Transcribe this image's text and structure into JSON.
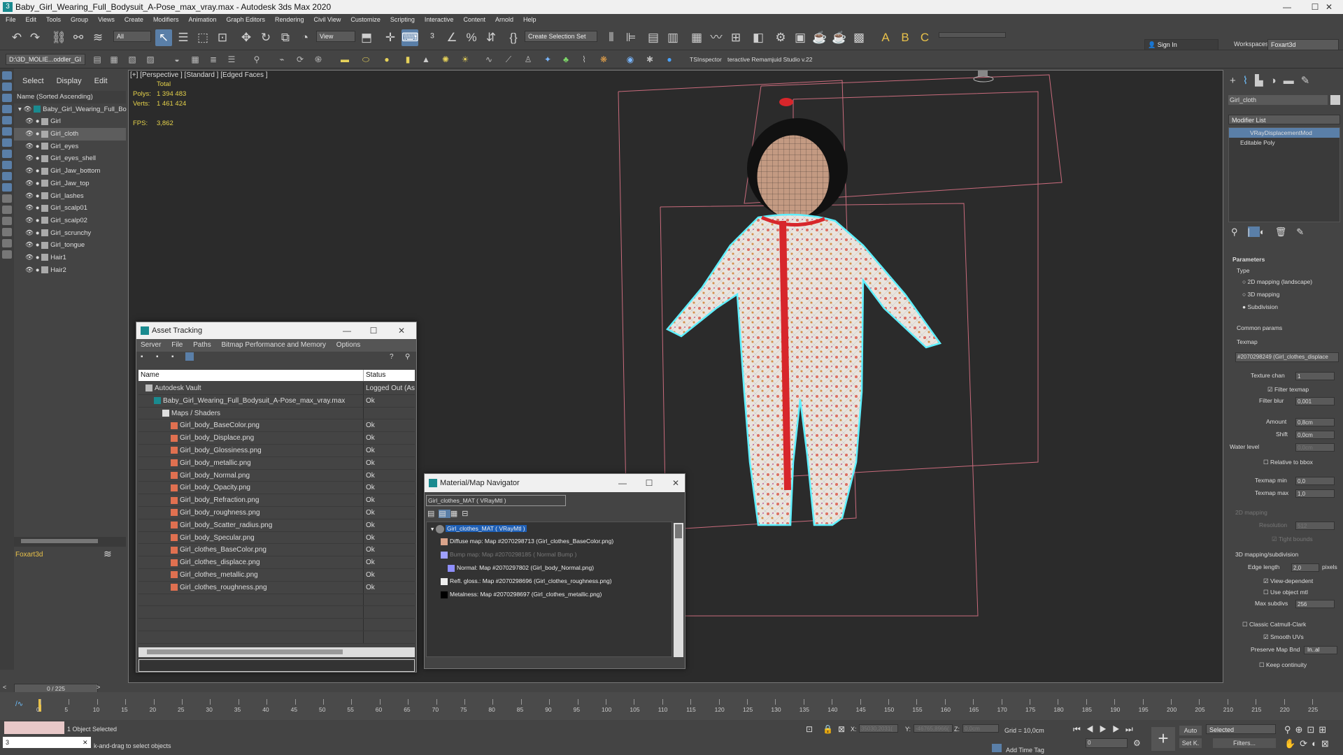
{
  "titlebar": {
    "title": "Baby_Girl_Wearing_Full_Bodysuit_A-Pose_max_vray.max - Autodesk 3ds Max 2020",
    "min": "—",
    "max": "☐",
    "close": "✕"
  },
  "menu": [
    "File",
    "Edit",
    "Tools",
    "Group",
    "Views",
    "Create",
    "Modifiers",
    "Animation",
    "Graph Editors",
    "Rendering",
    "Civil View",
    "Customize",
    "Scripting",
    "Interactive",
    "Content",
    "Arnold",
    "Help"
  ],
  "toolbar": {
    "filter": "All",
    "view": "View",
    "selection_set": "Create Selection Set",
    "sign_in": "Sign In",
    "workspaces_label": "Workspaces:",
    "workspace": "Foxart3d"
  },
  "toolbar2": {
    "path": "D:\\3D_MOLIE...oddler_GI",
    "ts": "TSInspector",
    "interactive": "teractive Remam",
    "studio": "juid Studio v.22"
  },
  "scene": {
    "tabs": [
      "Select",
      "Display",
      "Edit"
    ],
    "header": "Name (Sorted Ascending)",
    "root": "Baby_Girl_Wearing_Full_Bo",
    "items": [
      "Girl",
      "Girl_cloth",
      "Girl_eyes",
      "Girl_eyes_shell",
      "Girl_Jaw_bottom",
      "Girl_Jaw_top",
      "Girl_lashes",
      "Girl_scalp01",
      "Girl_scalp02",
      "Girl_scrunchy",
      "Girl_tongue",
      "Hair1",
      "Hair2"
    ],
    "selected": "Girl_cloth",
    "footer": "Foxart3d"
  },
  "viewport": {
    "label": "[+] [Perspective ] [Standard ] [Edged Faces ]",
    "total": "Total",
    "polys_label": "Polys:",
    "polys": "1 394 483",
    "verts_label": "Verts:",
    "verts": "1 461 424",
    "fps_label": "FPS:",
    "fps": "3,862"
  },
  "asset": {
    "title": "Asset Tracking",
    "menu": [
      "Server",
      "File",
      "Paths",
      "Bitmap Performance and Memory",
      "Options"
    ],
    "col_name": "Name",
    "col_status": "Status",
    "rows": [
      {
        "name": "Autodesk Vault",
        "status": "Logged Out (As",
        "indent": 0
      },
      {
        "name": "Baby_Girl_Wearing_Full_Bodysuit_A-Pose_max_vray.max",
        "status": "Ok",
        "indent": 1
      },
      {
        "name": "Maps / Shaders",
        "status": "",
        "indent": 2
      },
      {
        "name": "Girl_body_BaseColor.png",
        "status": "Ok",
        "indent": 3
      },
      {
        "name": "Girl_body_Displace.png",
        "status": "Ok",
        "indent": 3
      },
      {
        "name": "Girl_body_Glossiness.png",
        "status": "Ok",
        "indent": 3
      },
      {
        "name": "Girl_body_metallic.png",
        "status": "Ok",
        "indent": 3
      },
      {
        "name": "Girl_body_Normal.png",
        "status": "Ok",
        "indent": 3
      },
      {
        "name": "Girl_body_Opacity.png",
        "status": "Ok",
        "indent": 3
      },
      {
        "name": "Girl_body_Refraction.png",
        "status": "Ok",
        "indent": 3
      },
      {
        "name": "Girl_body_roughness.png",
        "status": "Ok",
        "indent": 3
      },
      {
        "name": "Girl_body_Scatter_radius.png",
        "status": "Ok",
        "indent": 3
      },
      {
        "name": "Girl_body_Specular.png",
        "status": "Ok",
        "indent": 3
      },
      {
        "name": "Girl_clothes_BaseColor.png",
        "status": "Ok",
        "indent": 3
      },
      {
        "name": "Girl_clothes_displace.png",
        "status": "Ok",
        "indent": 3
      },
      {
        "name": "Girl_clothes_metallic.png",
        "status": "Ok",
        "indent": 3
      },
      {
        "name": "Girl_clothes_roughness.png",
        "status": "Ok",
        "indent": 3
      }
    ]
  },
  "matnav": {
    "title": "Material/Map Navigator",
    "field": "Girl_clothes_MAT  ( VRayMtl )",
    "root": "Girl_clothes_MAT  ( VRayMtl )",
    "rows": [
      "Diffuse map: Map #2070298713 (Girl_clothes_BaseColor.png)",
      "Bump map: Map #2070298185  ( Normal Bump )",
      "Normal: Map #2070297802 (Girl_body_Normal.png)",
      "Refl. gloss.: Map #2070298696 (Girl_clothes_roughness.png)",
      "Metalness: Map #2070298697 (Girl_clothes_metallic.png)"
    ]
  },
  "cmd": {
    "object": "Girl_cloth",
    "modlist": "Modifier List",
    "stack": [
      "VRayDisplacementMod",
      "Editable Poly"
    ],
    "parameters": "Parameters",
    "type": "Type",
    "types": [
      "2D mapping (landscape)",
      "3D mapping",
      "Subdivision"
    ],
    "common": "Common params",
    "texmap": "Texmap",
    "texmap_val": "#2070298249 (Girl_clothes_displace",
    "texture_chan": "Texture chan",
    "texture_chan_val": "1",
    "filter_texmap": "Filter texmap",
    "filter_blur": "Filter blur",
    "filter_blur_val": "0,001",
    "amount": "Amount",
    "amount_val": "0,8cm",
    "shift": "Shift",
    "shift_val": "0,0cm",
    "water": "Water level",
    "water_val": "0,0cm",
    "relative": "Relative to bbox",
    "tmin": "Texmap min",
    "tmin_val": "0,0",
    "tmax": "Texmap max",
    "tmax_val": "1,0",
    "map2d": "2D mapping",
    "resolution": "Resolution",
    "resolution_val": "512",
    "tight": "Tight bounds",
    "sub": "3D mapping/subdivision",
    "edge": "Edge length",
    "edge_val": "2,0",
    "pixels": "pixels",
    "viewdep": "View-dependent",
    "useobj": "Use object mtl",
    "maxsub": "Max subdivs",
    "maxsub_val": "256",
    "classic": "Classic Catmull-Clark",
    "smooth": "Smooth UVs",
    "preserve": "Preserve Map Bnd",
    "preserve_val": "In..al",
    "keep": "Keep continuity"
  },
  "timeline": {
    "frame": "0 / 225",
    "ticks": [
      "0",
      "5",
      "10",
      "15",
      "20",
      "25",
      "30",
      "35",
      "40",
      "45",
      "50",
      "55",
      "60",
      "65",
      "70",
      "75",
      "80",
      "85",
      "90",
      "95",
      "100",
      "105",
      "110",
      "115",
      "120",
      "125",
      "130",
      "135",
      "140",
      "145",
      "150",
      "155",
      "160",
      "165",
      "170",
      "175",
      "180",
      "185",
      "190",
      "195",
      "200",
      "205",
      "210",
      "215",
      "220",
      "225"
    ]
  },
  "status": {
    "selected": "1 Object Selected",
    "hint": "k-and-drag to select objects",
    "x_label": "X:",
    "x": "35030,2031(",
    "y_label": "Y:",
    "y": "-46765,8966(",
    "z_label": "Z:",
    "z": "0,0cm",
    "grid": "Grid = 10,0cm",
    "addtag": "Add Time Tag",
    "auto": "Auto",
    "selected_combo": "Selected",
    "setk": "Set K.",
    "filters": "Filters...",
    "frame": "0"
  }
}
